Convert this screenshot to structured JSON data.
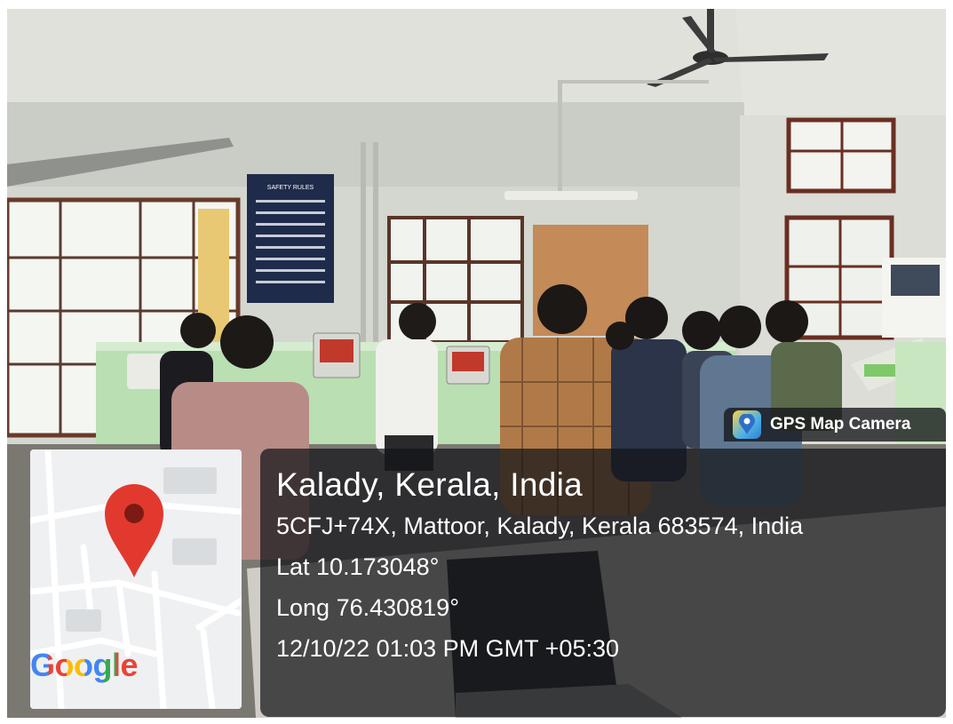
{
  "photo": {
    "scene_description_icon": "classroom-lab-photo",
    "poster_heading": "SAFETY RULES"
  },
  "stamp": {
    "app_name": "GPS Map Camera",
    "place": "Kalady, Kerala, India",
    "address": "5CFJ+74X, Mattoor, Kalady, Kerala 683574, India",
    "lat": "Lat 10.173048°",
    "long": "Long 76.430819°",
    "datetime": "12/10/22 01:03 PM GMT +05:30"
  },
  "map": {
    "logo_text": "Google",
    "pin_color": "#e2392f",
    "logo_colors": [
      "#4285f4",
      "#ea4335",
      "#fbbc05",
      "#4285f4",
      "#34a853",
      "#ea4335"
    ]
  }
}
